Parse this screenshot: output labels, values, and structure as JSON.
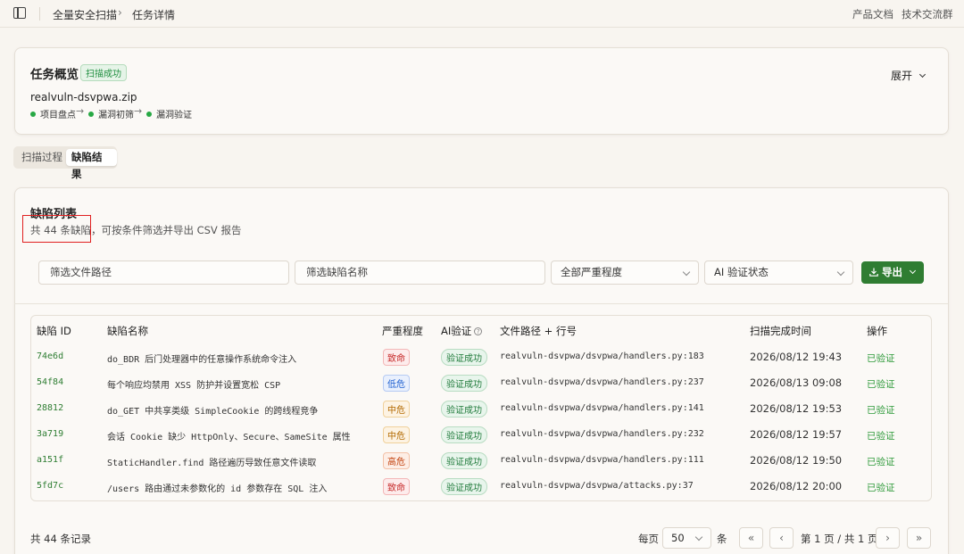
{
  "breadcrumb": {
    "root": "全量安全扫描",
    "sep": "›",
    "current": "任务详情"
  },
  "top_links": {
    "docs": "产品文档",
    "community": "技术交流群"
  },
  "overview": {
    "title": "任务概览",
    "status": "扫描成功",
    "expand": "展开",
    "filename": "realvuln-dsvpwa.zip",
    "steps": [
      "项目盘点",
      "漏洞初筛",
      "漏洞验证"
    ],
    "arrow": "→"
  },
  "tabs": [
    {
      "label": "扫描过程"
    },
    {
      "label": "缺陷结果"
    }
  ],
  "defects": {
    "title": "缺陷列表",
    "count_text": "共 44 条缺陷",
    "subtitle_rest": "，可按条件筛选并导出 CSV 报告"
  },
  "filters": {
    "file_path_placeholder": "筛选文件路径",
    "defect_name_placeholder": "筛选缺陷名称",
    "severity_value": "全部严重程度",
    "ai_value": "AI 验证状态",
    "export_label": "导出"
  },
  "table": {
    "headers": [
      "缺陷 ID",
      "缺陷名称",
      "严重程度",
      "AI验证",
      "文件路径 + 行号",
      "扫描完成时间",
      "操作"
    ],
    "help_icon": "?",
    "rows": [
      {
        "id": "74e6d",
        "name": "do_BDR 后门处理器中的任意操作系统命令注入",
        "severity": "致命",
        "ai": "验证成功",
        "path": "realvuln-dsvpwa/dsvpwa/handlers.py:183",
        "time": "2026/08/12 19:43",
        "action": "已验证"
      },
      {
        "id": "54f84",
        "name": "每个响应均禁用 XSS 防护并设置宽松 CSP",
        "severity": "低危",
        "ai": "验证成功",
        "path": "realvuln-dsvpwa/dsvpwa/handlers.py:237",
        "time": "2026/08/13 09:08",
        "action": "已验证"
      },
      {
        "id": "28812",
        "name": "do_GET 中共享类级 SimpleCookie 的跨线程竞争",
        "severity": "中危",
        "ai": "验证成功",
        "path": "realvuln-dsvpwa/dsvpwa/handlers.py:141",
        "time": "2026/08/12 19:53",
        "action": "已验证"
      },
      {
        "id": "3a719",
        "name": "会话 Cookie 缺少 HttpOnly、Secure、SameSite 属性",
        "severity": "中危",
        "ai": "验证成功",
        "path": "realvuln-dsvpwa/dsvpwa/handlers.py:232",
        "time": "2026/08/12 19:57",
        "action": "已验证"
      },
      {
        "id": "a151f",
        "name": "StaticHandler.find 路径遍历导致任意文件读取",
        "severity": "高危",
        "ai": "验证成功",
        "path": "realvuln-dsvpwa/dsvpwa/handlers.py:111",
        "time": "2026/08/12 19:50",
        "action": "已验证"
      },
      {
        "id": "5fd7c",
        "name": "/users 路由通过未参数化的 id 参数存在 SQL 注入",
        "severity": "致命",
        "ai": "验证成功",
        "path": "realvuln-dsvpwa/dsvpwa/attacks.py:37",
        "time": "2026/08/12 20:00",
        "action": "已验证"
      }
    ]
  },
  "footer": {
    "total": "共 44 条记录",
    "per_page_label": "每页",
    "page_size": "50",
    "unit": "条",
    "first": "«",
    "prev": "‹",
    "page_info": "第 1 页 / 共 1 页",
    "next": "›",
    "last": "»"
  },
  "colors": {
    "accent_green": "#2f7d32",
    "highlight_red": "#e02020"
  }
}
